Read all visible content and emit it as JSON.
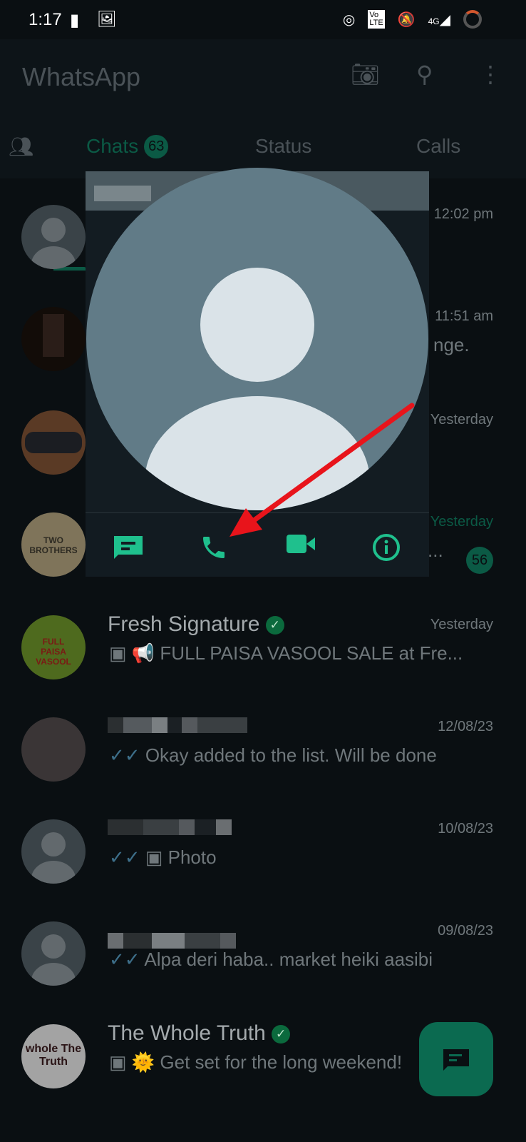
{
  "status_bar": {
    "time": "1:17",
    "network": "4G"
  },
  "app_bar": {
    "title": "WhatsApp"
  },
  "tabs": [
    {
      "label": "Chats",
      "badge": "63"
    },
    {
      "label": "Status"
    },
    {
      "label": "Calls"
    }
  ],
  "chats": [
    {
      "name": "",
      "time": "12:02 pm",
      "message": ""
    },
    {
      "name": "",
      "time": "11:51 am",
      "message": "nge."
    },
    {
      "name": "",
      "time": "Yesterday",
      "message": ""
    },
    {
      "name": "",
      "time": "Yesterday",
      "message": "...",
      "unread": "56"
    },
    {
      "name": "Fresh Signature",
      "time": "Yesterday",
      "message": "📢 FULL PAISA VASOOL SALE at Fre..."
    },
    {
      "name": "",
      "time": "12/08/23",
      "message": "Okay added to the list. Will be done"
    },
    {
      "name": "",
      "time": "10/08/23",
      "message": "Photo"
    },
    {
      "name": "",
      "time": "09/08/23",
      "message": "Alpa deri haba.. market heiki aasibi"
    },
    {
      "name": "The Whole Truth",
      "time": "",
      "message": "🌞 Get set for the long weekend!"
    }
  ],
  "avatar_logos": {
    "two_brothers": "TWO BROTHERS",
    "whole_truth": "whole The Truth",
    "full_paisa": "FULL PAISA VASOOL"
  },
  "colors": {
    "accent": "#1fc08d",
    "arrow": "#e8141b"
  }
}
